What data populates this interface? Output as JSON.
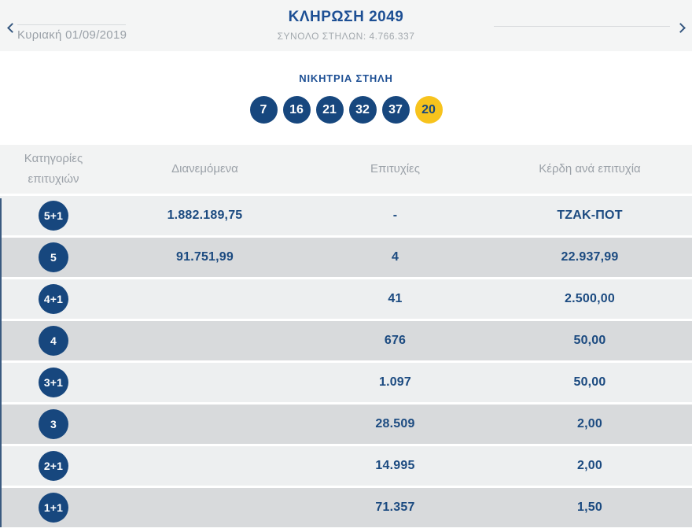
{
  "nav": {
    "date": "Κυριακή 01/09/2019",
    "title": "ΚΛΗΡΩΣΗ 2049",
    "total_columns": "ΣΥΝΟΛΟ ΣΤΗΛΩΝ: 4.766.337"
  },
  "winning": {
    "title": "ΝΙΚΗΤΡΙΑ ΣΤΗΛΗ",
    "numbers": [
      "7",
      "16",
      "21",
      "32",
      "37"
    ],
    "bonus": "20"
  },
  "table": {
    "headers": [
      "Κατηγορίες επιτυχιών",
      "Διανεμόμενα",
      "Επιτυχίες",
      "Κέρδη ανά επιτυχία"
    ],
    "rows": [
      {
        "category": "5+1",
        "distributed": "1.882.189,75",
        "winners": "-",
        "prize": "ΤΖΑΚ-ΠΟΤ"
      },
      {
        "category": "5",
        "distributed": "91.751,99",
        "winners": "4",
        "prize": "22.937,99"
      },
      {
        "category": "4+1",
        "distributed": "",
        "winners": "41",
        "prize": "2.500,00"
      },
      {
        "category": "4",
        "distributed": "",
        "winners": "676",
        "prize": "50,00"
      },
      {
        "category": "3+1",
        "distributed": "",
        "winners": "1.097",
        "prize": "50,00"
      },
      {
        "category": "3",
        "distributed": "",
        "winners": "28.509",
        "prize": "2,00"
      },
      {
        "category": "2+1",
        "distributed": "",
        "winners": "14.995",
        "prize": "2,00"
      },
      {
        "category": "1+1",
        "distributed": "",
        "winners": "71.357",
        "prize": "1,50"
      }
    ]
  },
  "colors": {
    "navy": "#17477e",
    "title_blue": "#1d4f94",
    "bonus_yellow": "#f7c31d",
    "row_light": "#edeff0",
    "row_dark": "#d8dadc",
    "header_text_gray": "#9ba1a8"
  }
}
